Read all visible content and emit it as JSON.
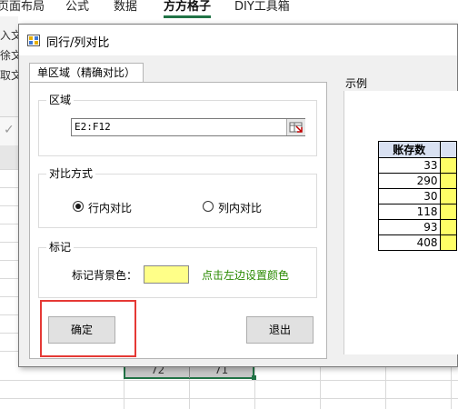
{
  "excel": {
    "ribbon_tabs": [
      "页面布局",
      "公式",
      "数据",
      "方方格子",
      "DIY工具箱"
    ],
    "side_labels": [
      "入文",
      "徐文",
      "取文"
    ],
    "selected_cells": [
      "72",
      "71"
    ]
  },
  "dialog": {
    "title": "同行/列对比",
    "tab_label": "单区域（精确对比）",
    "region": {
      "title": "区域",
      "value": "E2:F12"
    },
    "compare": {
      "title": "对比方式",
      "options": [
        "行内对比",
        "列内对比"
      ],
      "selected": "行内对比"
    },
    "mark": {
      "title": "标记",
      "bg_label": "标记背景色：",
      "bg_color": "#ffff88",
      "hint": "点击左边设置颜色"
    },
    "buttons": {
      "ok": "确定",
      "exit": "退出"
    },
    "example": {
      "title": "示例",
      "header": "账存数",
      "values": [
        "33",
        "290",
        "30",
        "118",
        "93",
        "408"
      ]
    }
  },
  "colors": {
    "accent_green": "#217346",
    "highlight_red": "#e53935",
    "hint_green": "#2a8a00"
  }
}
